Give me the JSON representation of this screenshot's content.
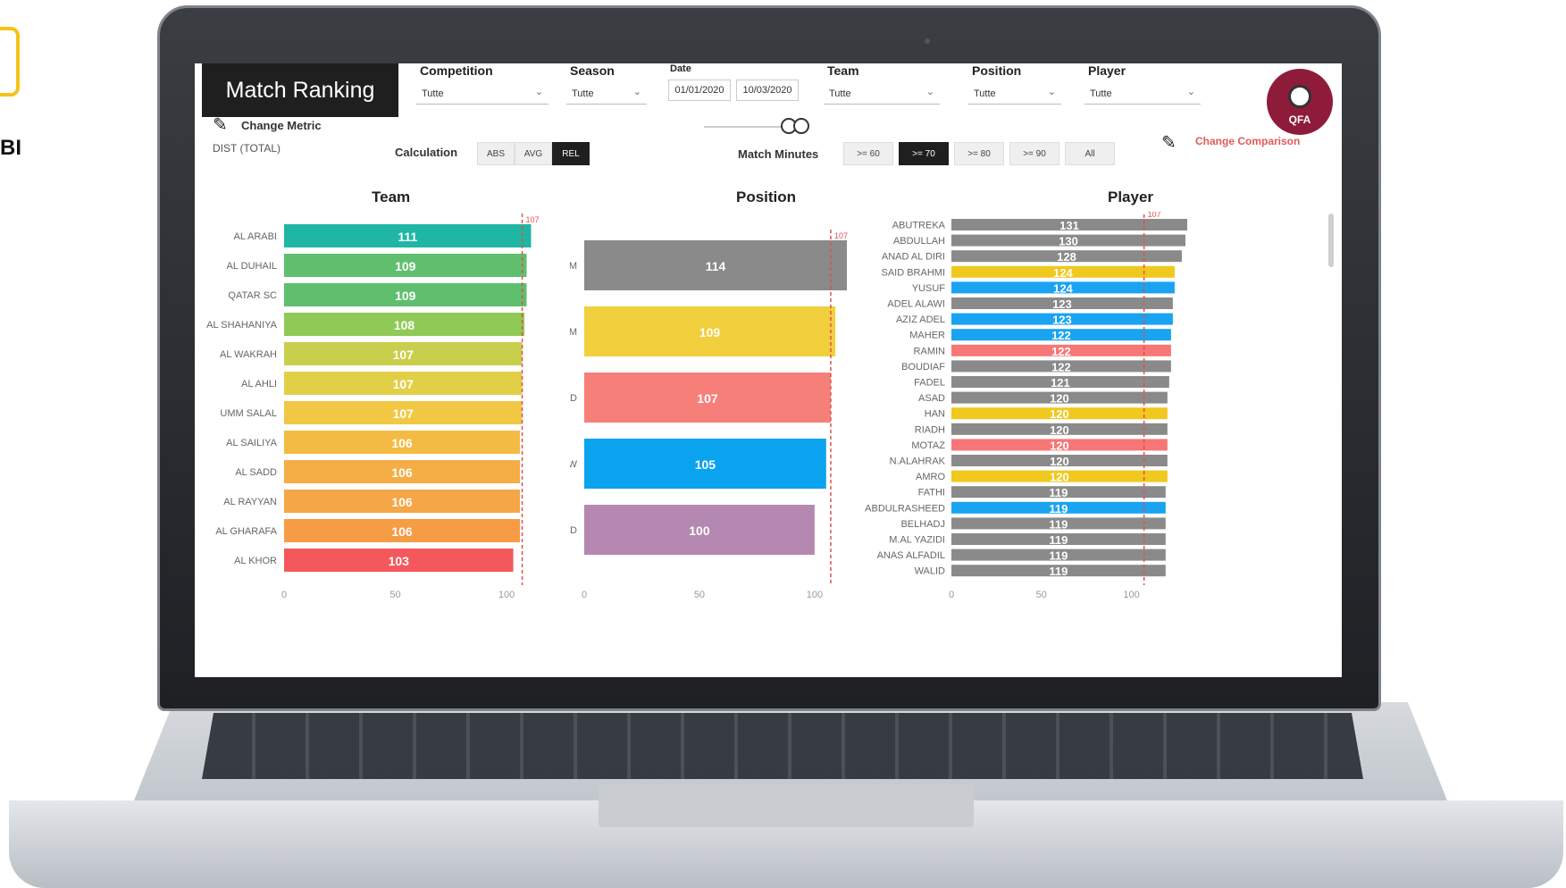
{
  "page_corner": {
    "text": "BI"
  },
  "header": {
    "title": "Match Ranking",
    "filters": {
      "competition": {
        "label": "Competition",
        "value": "Tutte"
      },
      "season": {
        "label": "Season",
        "value": "Tutte"
      },
      "date": {
        "label": "Date",
        "start": "01/01/2020",
        "end": "10/03/2020"
      },
      "team": {
        "label": "Team",
        "value": "Tutte"
      },
      "position": {
        "label": "Position",
        "value": "Tutte"
      },
      "player": {
        "label": "Player",
        "value": "Tutte"
      }
    },
    "logo_text": "QFA"
  },
  "controls": {
    "change_metric": "Change Metric",
    "metric_value": "DIST (TOTAL)",
    "calculation_label": "Calculation",
    "calculation_options": [
      "ABS",
      "AVG",
      "REL"
    ],
    "calculation_selected": "REL",
    "match_minutes_label": "Match Minutes",
    "match_minutes_options": [
      ">= 60",
      ">= 70",
      ">= 80",
      ">= 90",
      "All"
    ],
    "match_minutes_selected": ">= 70",
    "change_comparison": "Change Comparison"
  },
  "chart_data": [
    {
      "type": "bar",
      "title": "Team",
      "orientation": "horizontal",
      "categories": [
        "AL ARABI",
        "AL DUHAIL",
        "QATAR SC",
        "AL SHAHANIYA",
        "AL WAKRAH",
        "AL AHLI",
        "UMM SALAL",
        "AL SAILIYA",
        "AL SADD",
        "AL RAYYAN",
        "AL GHARAFA",
        "AL KHOR"
      ],
      "values": [
        111,
        109,
        109,
        108,
        107,
        107,
        107,
        106,
        106,
        106,
        106,
        103
      ],
      "colors": [
        "#1fb6a4",
        "#5fbf6f",
        "#5fbf6f",
        "#8fc956",
        "#c9cf4c",
        "#e2cf48",
        "#f1c744",
        "#f3bb43",
        "#f5ad45",
        "#f5a646",
        "#f69c45",
        "#f4585c"
      ],
      "reference_line": 107,
      "reference_label": "107",
      "xlim": [
        0,
        110
      ],
      "xticks": [
        0,
        50,
        100
      ]
    },
    {
      "type": "bar",
      "title": "Position",
      "orientation": "horizontal",
      "categories": [
        "CM",
        "WM",
        "WD",
        "FW",
        "CD"
      ],
      "values": [
        114,
        109,
        107,
        105,
        100
      ],
      "colors": [
        "#8a8a8a",
        "#f1cf3d",
        "#f77f7a",
        "#0aa3f0",
        "#b488b0"
      ],
      "reference_line": 107,
      "reference_label": "107",
      "xlim": [
        0,
        114
      ],
      "xticks": [
        0,
        50,
        100
      ]
    },
    {
      "type": "bar",
      "title": "Player",
      "orientation": "horizontal",
      "categories": [
        "ABUTREKA",
        "ABDULLAH",
        "ANAD AL DIRI",
        "SAID BRAHMI",
        "YUSUF",
        "ADEL ALAWI",
        "AZIZ ADEL",
        "MAHER",
        "RAMIN",
        "BOUDIAF",
        "FADEL",
        "ASAD",
        "HAN",
        "RIADH",
        "MOTAZ",
        "N.ALAHRAK",
        "AMRO",
        "FATHI",
        "ABDULRASHEED",
        "BELHADJ",
        "M.AL YAZIDI",
        "ANAS ALFADIL",
        "WALID"
      ],
      "values": [
        131,
        130,
        128,
        124,
        124,
        123,
        123,
        122,
        122,
        122,
        121,
        120,
        120,
        120,
        120,
        120,
        120,
        119,
        119,
        119,
        119,
        119,
        119
      ],
      "colors": [
        "#8a8a8a",
        "#8a8a8a",
        "#8a8a8a",
        "#f1c81e",
        "#1aa3f0",
        "#8a8a8a",
        "#1aa3f0",
        "#1aa3f0",
        "#f77676",
        "#8a8a8a",
        "#8a8a8a",
        "#8a8a8a",
        "#f1c81e",
        "#8a8a8a",
        "#f77676",
        "#8a8a8a",
        "#f1c81e",
        "#8a8a8a",
        "#1aa3f0",
        "#8a8a8a",
        "#8a8a8a",
        "#8a8a8a",
        "#8a8a8a"
      ],
      "reference_line": 107,
      "reference_label": "107",
      "xlim": [
        0,
        131
      ],
      "xticks": [
        0,
        50,
        100
      ]
    }
  ]
}
